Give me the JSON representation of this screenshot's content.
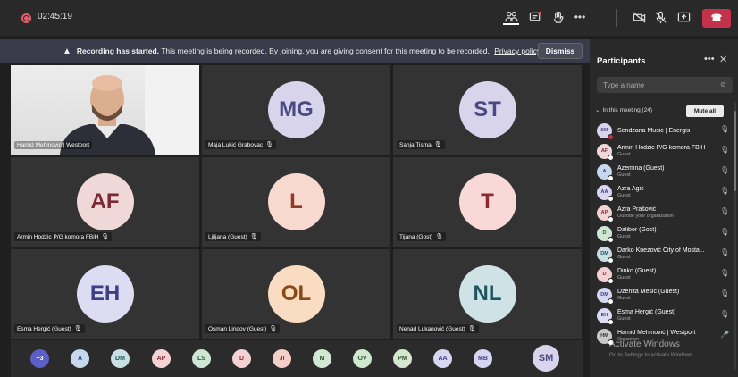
{
  "meeting": {
    "timer": "02:45:19",
    "leave_label": "Leave"
  },
  "banner": {
    "bold": "Recording has started.",
    "text": "This meeting is being recorded. By joining, you are giving consent for this meeting to be recorded.",
    "link": "Privacy policy",
    "dismiss_label": "Dismiss"
  },
  "tiles": [
    {
      "label": "Hamid Mehinovic | Westport",
      "initials": "",
      "video": true
    },
    {
      "label": "Maja Lukić Grabovac",
      "initials": "MG",
      "color": "#d7d4ec",
      "text_color": "#4b4a80"
    },
    {
      "label": "Sanja Tisma",
      "initials": "ST",
      "color": "#d7d4ec",
      "text_color": "#4b4a80"
    },
    {
      "label": "Armin Hodzic P/G komora FBiH",
      "initials": "AF",
      "color": "#f0d7d8",
      "text_color": "#7a2a34"
    },
    {
      "label": "Ljiljana (Guest)",
      "initials": "L",
      "color": "#f8d9cf",
      "text_color": "#8e3a24"
    },
    {
      "label": "Tijana (Gost)",
      "initials": "T",
      "color": "#f8d9d8",
      "text_color": "#8a2b32"
    },
    {
      "label": "Esma Hergić (Guest)",
      "initials": "EH",
      "color": "#dcdcf2",
      "text_color": "#3e3e86"
    },
    {
      "label": "Osman Lindov (Guest)",
      "initials": "OL",
      "color": "#f9dcc2",
      "text_color": "#8a4a16"
    },
    {
      "label": "Nenad Lukanović (Guest)",
      "initials": "NL",
      "color": "#cfe2e6",
      "text_color": "#1d5560"
    }
  ],
  "strip": [
    {
      "initials": "+3",
      "color": "#5b5fc7",
      "text_color": "#ffffff"
    },
    {
      "initials": "A",
      "color": "#c7d8ee",
      "text_color": "#204a7a"
    },
    {
      "initials": "DM",
      "color": "#c9dfe2",
      "text_color": "#1d5560"
    },
    {
      "initials": "AP",
      "color": "#f3d3d6",
      "text_color": "#8a2b32"
    },
    {
      "initials": "LS",
      "color": "#cfe7d2",
      "text_color": "#24603a"
    },
    {
      "initials": "D",
      "color": "#f4d1d4",
      "text_color": "#8a2b32"
    },
    {
      "initials": "JI",
      "color": "#f4cfc7",
      "text_color": "#8e3a24"
    },
    {
      "initials": "M",
      "color": "#d3e8d2",
      "text_color": "#2d5e2c"
    },
    {
      "initials": "OV",
      "color": "#cfe6cf",
      "text_color": "#2f602f"
    },
    {
      "initials": "PM",
      "color": "#d6e6d3",
      "text_color": "#2f5a2c"
    },
    {
      "initials": "AA",
      "color": "#d8d6f0",
      "text_color": "#3e3e86"
    },
    {
      "initials": "MB",
      "color": "#d6d6f0",
      "text_color": "#3e3e86"
    },
    {
      "initials": "SM",
      "color": "#d7d4ec",
      "text_color": "#4b4a80"
    }
  ],
  "panel": {
    "title": "Participants",
    "search_placeholder": "Type a name",
    "section": "In this meeting (24)",
    "mute_all": "Mute all",
    "items": [
      {
        "initials": "SM",
        "name": "Sendzana Music | Energis",
        "role": "",
        "color": "#d7d4ec",
        "text_color": "#4b4a80",
        "busy": true
      },
      {
        "initials": "AF",
        "name": "Armin Hodzic P/G komora FBiH",
        "role": "Guest",
        "color": "#f0d7d8",
        "text_color": "#7a2a34"
      },
      {
        "initials": "A",
        "name": "Azemina (Guest)",
        "role": "Guest",
        "color": "#c7d8ee",
        "text_color": "#204a7a"
      },
      {
        "initials": "AA",
        "name": "Azra Agić",
        "role": "Guest",
        "color": "#d8d6f0",
        "text_color": "#3e3e86"
      },
      {
        "initials": "AP",
        "name": "Azra Prašović",
        "role": "Outside your organization",
        "color": "#f3d3d6",
        "text_color": "#8a2b32"
      },
      {
        "initials": "D",
        "name": "Dalibor (Gost)",
        "role": "Guest",
        "color": "#cfe7d2",
        "text_color": "#24603a"
      },
      {
        "initials": "DM",
        "name": "Darko Knezović City of Mosta...",
        "role": "Guest",
        "color": "#c9dfe2",
        "text_color": "#1d5560"
      },
      {
        "initials": "D",
        "name": "Dinko (Guest)",
        "role": "Guest",
        "color": "#f4d1d4",
        "text_color": "#8a2b32"
      },
      {
        "initials": "DM",
        "name": "Dženita Mesić (Guest)",
        "role": "Guest",
        "color": "#d6d6f0",
        "text_color": "#3e3e86"
      },
      {
        "initials": "EH",
        "name": "Esma Hergić (Guest)",
        "role": "Guest",
        "color": "#dcdcf2",
        "text_color": "#3e3e86"
      },
      {
        "initials": "HM",
        "name": "Hamid Mehinović | Westport",
        "role": "Organizer",
        "color": "#c8c8c8",
        "text_color": "#333333"
      }
    ],
    "watermark": "Activate Windows",
    "watermark_sub": "Go to Settings to activate Windows."
  }
}
